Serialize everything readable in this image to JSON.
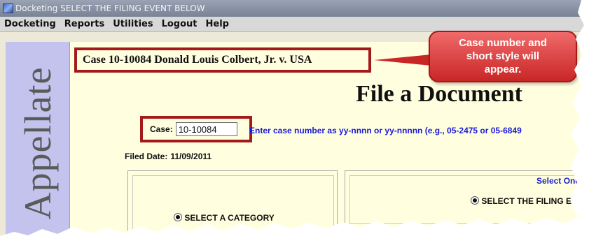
{
  "window": {
    "title": "Docketing SELECT THE FILING EVENT BELOW"
  },
  "menu": {
    "items": [
      "Docketing",
      "Reports",
      "Utilities",
      "Logout",
      "Help"
    ]
  },
  "banner": {
    "text": "Appellate"
  },
  "case_heading": "Case 10-10084 Donald Louis Colbert, Jr. v. USA",
  "page_title": "File a Document",
  "case_field": {
    "label": "Case:",
    "value": "10-10084"
  },
  "case_hint": "Enter case number as yy-nnnn or yy-nnnnn (e.g., 05-2475 or 05-6849",
  "filed_date": {
    "label": "Filed Date:",
    "value": "11/09/2011"
  },
  "category": {
    "label": "SELECT A CATEGORY"
  },
  "event": {
    "select_one": "Select One",
    "label": "SELECT THE FILING E"
  },
  "callout": {
    "text": "Case number and short style will appear."
  },
  "colors": {
    "accent_red": "#a21a1a",
    "hint_blue": "#1a1ad6",
    "panel_yellow": "#ffffe0",
    "banner_lavender": "#c4c3ee"
  }
}
